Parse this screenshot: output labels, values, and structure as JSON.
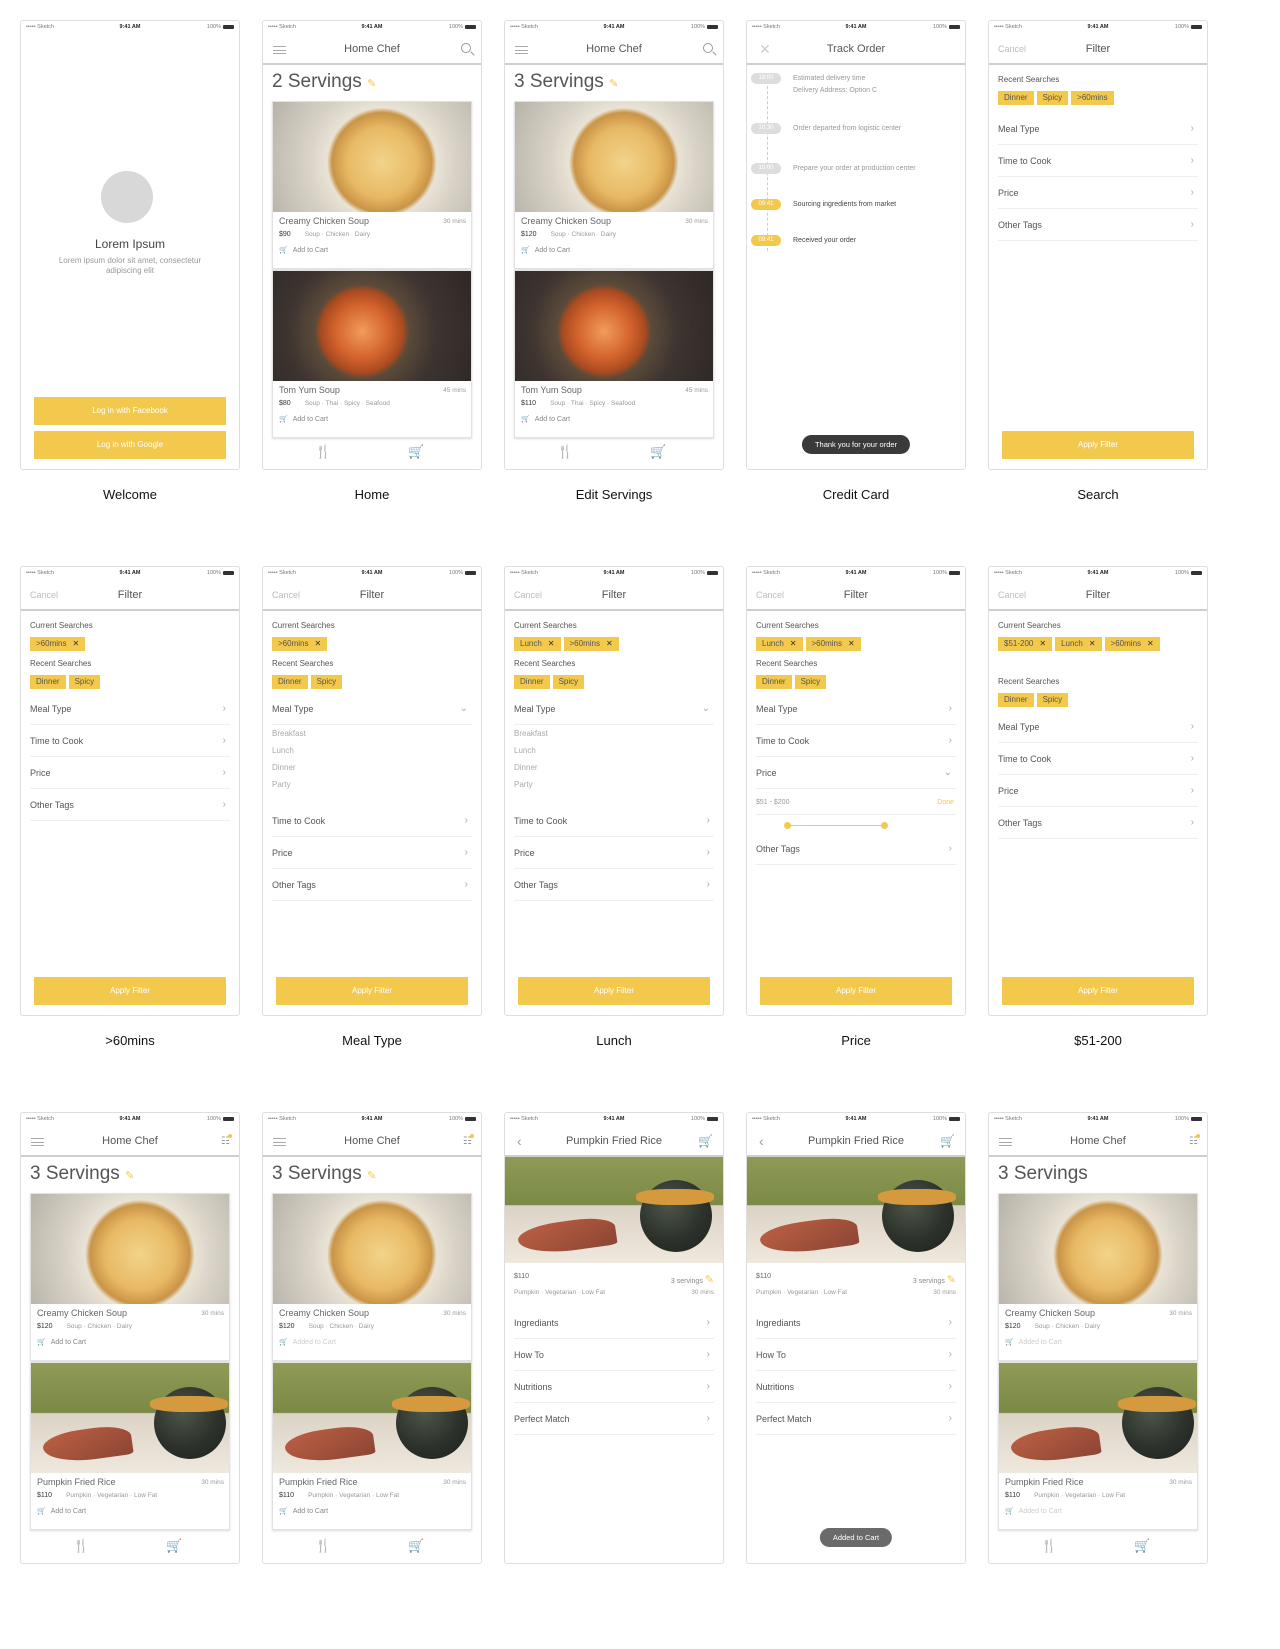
{
  "statusbar": {
    "carrier": "••••• Sketch",
    "time": "9:41 AM",
    "battery": "100%"
  },
  "common": {
    "home_title": "Home Chef",
    "filter_title": "Filter",
    "cancel": "Cancel",
    "apply": "Apply Filter",
    "current_searches": "Current Searches",
    "recent_searches": "Recent Searches",
    "meal_type": "Meal Type",
    "time_to_cook": "Time to Cook",
    "price": "Price",
    "other_tags": "Other Tags",
    "add_to_cart": "Add to Cart",
    "added_to_cart": "Added to Cart"
  },
  "recent_chips": [
    "Dinner",
    "Spicy"
  ],
  "meal_types": [
    "Breakfast",
    "Lunch",
    "Dinner",
    "Party"
  ],
  "dishes": {
    "creamy": {
      "name": "Creamy Chicken Soup",
      "mins": "30 mins",
      "tags": "Soup · Chicken · Dairy",
      "price_2": "$90",
      "price_3": "$120"
    },
    "tomyum": {
      "name": "Tom Yum Soup",
      "mins": "45 mins",
      "tags": "Soup · Thai · Spicy · Seafood",
      "price_2": "$80",
      "price_3": "$110"
    },
    "pumpkin": {
      "name": "Pumpkin Fried Rice",
      "mins": "30 mins",
      "tags": "Pumpkin · Vegetarian · Low Fat",
      "price": "$110",
      "servings": "3 servings"
    }
  },
  "servings": {
    "two": "2 Servings",
    "three": "3 Servings"
  },
  "welcome": {
    "title": "Lorem Ipsum",
    "subtitle": "Lorem ipsum dolor sit amet, consectetur adipiscing elit",
    "facebook": "Log in with Facebook",
    "google": "Log in with Google"
  },
  "track": {
    "title": "Track Order",
    "events": [
      {
        "time": "18:00",
        "text": "Estimated delivery time",
        "text2": "Delivery Address: Option C",
        "active": false
      },
      {
        "time": "10:30",
        "text": "Order departed from logistic center",
        "text2": "",
        "active": false
      },
      {
        "time": "10:00",
        "text": "Prepare your order at production center",
        "text2": "",
        "active": false
      },
      {
        "time": "09:41",
        "text": "Sourcing ingredients from market",
        "text2": "",
        "active": true
      },
      {
        "time": "09:41",
        "text": "Received your order",
        "text2": "",
        "active": true
      }
    ],
    "toast": "Thank you for your order"
  },
  "search": {
    "chips": [
      "Dinner",
      "Spicy",
      ">60mins"
    ]
  },
  "chip_60": ">60mins",
  "chip_lunch": "Lunch",
  "chip_price": "$51-200",
  "price_range": {
    "label": "$51 - $200",
    "done": "Done"
  },
  "detail": {
    "title": "Pumpkin Fried Rice",
    "items": [
      "Ingrediants",
      "How To",
      "Nutritions",
      "Perfect Match"
    ],
    "toast": "Added to Cart"
  },
  "captions": [
    "Welcome",
    "Home",
    "Edit Servings",
    "Credit Card",
    "Search",
    ">60mins",
    "Meal Type",
    "Lunch",
    "Price",
    "$51-200"
  ]
}
